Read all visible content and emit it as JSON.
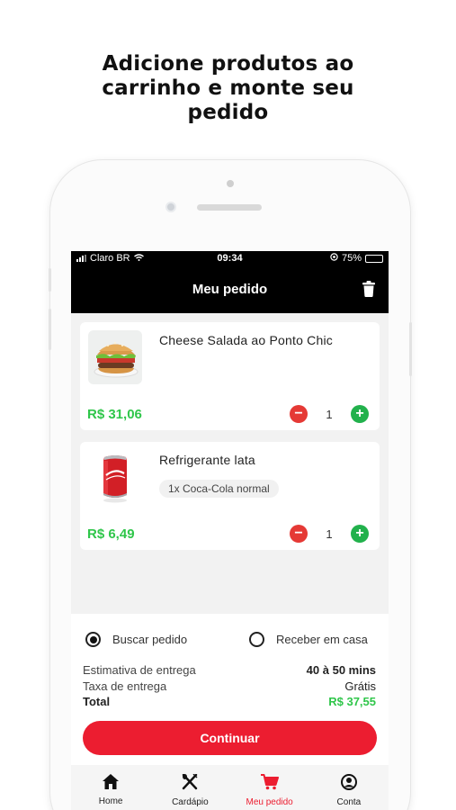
{
  "promo": {
    "headline_lines": [
      "Adicione produtos ao",
      "carrinho e monte seu",
      "pedido"
    ]
  },
  "status_bar": {
    "carrier": "Claro BR",
    "time": "09:34",
    "battery": "75%",
    "battery_level": 0.75,
    "battery_color": "#f7d23a"
  },
  "header": {
    "title": "Meu pedido",
    "action_icon": "trash-icon"
  },
  "cart": {
    "items": [
      {
        "name": "Cheese Salada ao Ponto Chic",
        "price": "R$ 31,06",
        "quantity": "1",
        "image_icon": "burger-image"
      },
      {
        "name": "Refrigerante lata",
        "option": "1x  Coca-Cola normal",
        "price": "R$ 6,49",
        "quantity": "1",
        "image_icon": "soda-can-image"
      }
    ]
  },
  "delivery": {
    "pickup_label": "Buscar pedido",
    "delivery_label": "Receber em casa",
    "selected": "pickup"
  },
  "summary": {
    "estimate_label": "Estimativa de entrega",
    "estimate_value": "40 à 50 mins",
    "fee_label": "Taxa de entrega",
    "fee_value": "Grátis",
    "total_label": "Total",
    "total_value": "R$ 37,55"
  },
  "cta": {
    "label": "Continuar"
  },
  "tabbar": {
    "tabs": [
      {
        "label": "Home",
        "icon": "home-icon"
      },
      {
        "label": "Cardápio",
        "icon": "cutlery-icon"
      },
      {
        "label": "Meu pedido",
        "icon": "cart-icon",
        "active": true
      },
      {
        "label": "Conta",
        "icon": "account-icon"
      }
    ]
  },
  "colors": {
    "accent_red": "#ec1d30",
    "price_green": "#2fc64a",
    "plus_green": "#22b14c",
    "minus_red": "#e53935"
  }
}
